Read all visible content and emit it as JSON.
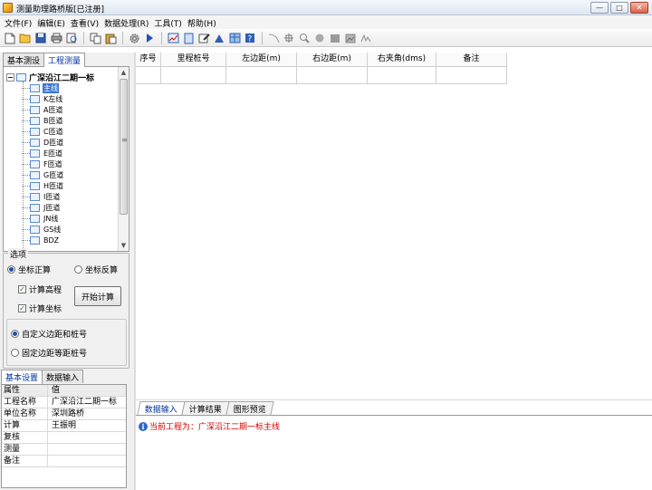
{
  "window": {
    "title": "测量助理路桥版[已注册]",
    "controls": [
      "—",
      "□",
      "✕"
    ]
  },
  "menu": [
    {
      "label": "文件(F)"
    },
    {
      "label": "编辑(E)"
    },
    {
      "label": "查看(V)"
    },
    {
      "label": "数据处理(R)"
    },
    {
      "label": "工具(T)"
    },
    {
      "label": "帮助(H)"
    }
  ],
  "toolbar": {
    "groups": [
      [
        "new-file-icon",
        "open-folder-icon",
        "save-icon",
        "print-icon",
        "print-preview-icon"
      ],
      [
        "copy-icon",
        "paste-icon"
      ],
      [
        "settings-gear-icon",
        "run-icon"
      ],
      [
        "chart-icon",
        "document-icon",
        "edit-icon",
        "survey-icon",
        "table-icon",
        "help-icon"
      ],
      [
        "curve-icon",
        "crosshair-icon",
        "zoom-icon",
        "pan-icon",
        "square-icon",
        "image-icon",
        "signature-icon"
      ]
    ]
  },
  "left_tabs": [
    {
      "label": "基本测设",
      "active": false
    },
    {
      "label": "工程测量",
      "active": true
    }
  ],
  "tree": {
    "root": "广深沿江二期一标",
    "items": [
      {
        "label": "主线",
        "selected": true
      },
      {
        "label": "K左线"
      },
      {
        "label": "A匝道"
      },
      {
        "label": "B匝道"
      },
      {
        "label": "C匝道"
      },
      {
        "label": "D匝道"
      },
      {
        "label": "E匝道"
      },
      {
        "label": "F匝道"
      },
      {
        "label": "G匝道"
      },
      {
        "label": "H匝道"
      },
      {
        "label": "I匝道"
      },
      {
        "label": "J匝道"
      },
      {
        "label": "JN线"
      },
      {
        "label": "GS线"
      },
      {
        "label": "BDZ"
      }
    ]
  },
  "options": {
    "legend": "选项",
    "radio_forward": "坐标正算",
    "radio_inverse": "坐标反算",
    "check_elevation": "计算高程",
    "check_coords": "计算坐标",
    "start_button": "开始计算",
    "radio_custom": "自定义边距和桩号",
    "radio_fixed": "固定边距等距桩号"
  },
  "mid_tabs": [
    {
      "label": "基本设置",
      "active": true
    },
    {
      "label": "数据输入",
      "active": false
    }
  ],
  "properties": {
    "header": {
      "key": "属性",
      "value": "值"
    },
    "rows": [
      {
        "key": "工程名称",
        "value": "广深沿江二期一标"
      },
      {
        "key": "单位名称",
        "value": "深圳路桥"
      },
      {
        "key": "计算",
        "value": "王振明"
      },
      {
        "key": "复核",
        "value": ""
      },
      {
        "key": "测量",
        "value": ""
      },
      {
        "key": "备注",
        "value": ""
      }
    ]
  },
  "table": {
    "columns": [
      "序号",
      "里程桩号",
      "左边距(m)",
      "右边距(m)",
      "右夹角(dms)",
      "备注"
    ]
  },
  "bottom_tabs": [
    {
      "label": "数据输入",
      "active": true
    },
    {
      "label": "计算结果",
      "active": false
    },
    {
      "label": "图形预览",
      "active": false
    }
  ],
  "status_message": "当前工程为：广深沿江二期一标主线"
}
